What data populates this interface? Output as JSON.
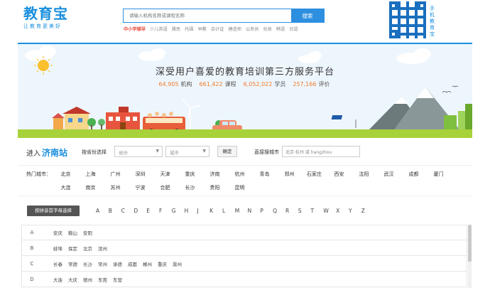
{
  "header": {
    "logo_main": "教育宝",
    "logo_sub": "让教育更美好",
    "search_placeholder": "请输入机构名称或课程名称",
    "search_button": "搜索",
    "hot_links": [
      "中小学辅导",
      "少儿英语",
      "雅思",
      "托福",
      "早教",
      "会计证",
      "建造师",
      "公务员",
      "化妆",
      "韩语",
      "日语"
    ],
    "qr_label": "手机教育宝"
  },
  "banner": {
    "title": "深受用户喜爱的教育培训第三方服务平台",
    "stats": [
      {
        "value": "64,905",
        "label": "机构"
      },
      {
        "value": "661,422",
        "label": "课程"
      },
      {
        "value": "6,052,022",
        "label": "学员"
      },
      {
        "value": "257,166",
        "label": "评价"
      }
    ]
  },
  "location": {
    "enter_label": "进入",
    "city": "济南站",
    "province_label": "按省份选择",
    "province_select": "省份",
    "city_select": "城市",
    "confirm": "确定",
    "direct_label": "直接搜城市",
    "direct_placeholder": "北京 杭州 或 hangzhou"
  },
  "hot_cities": {
    "label": "热门城市：",
    "row1": [
      "北京",
      "上海",
      "广州",
      "深圳",
      "天津",
      "重庆",
      "济南",
      "杭州",
      "青岛",
      "郑州",
      "石家庄",
      "西安",
      "沈阳",
      "武汉",
      "成都",
      "厦门"
    ],
    "row2": [
      "大连",
      "南京",
      "苏州",
      "宁波",
      "合肥",
      "长沙",
      "贵阳",
      "昆明"
    ]
  },
  "alphabet": {
    "tag": "按拼音首字母选择",
    "letters": [
      "A",
      "B",
      "C",
      "D",
      "E",
      "F",
      "G",
      "H",
      "J",
      "K",
      "L",
      "M",
      "N",
      "P",
      "Q",
      "R",
      "S",
      "T",
      "W",
      "X",
      "Y",
      "Z"
    ]
  },
  "letter_rows": [
    {
      "key": "A",
      "cities": [
        "安庆",
        "鞍山",
        "安阳"
      ]
    },
    {
      "key": "B",
      "cities": [
        "蚌埠",
        "保定",
        "北京",
        "滨州"
      ]
    },
    {
      "key": "C",
      "cities": [
        "长春",
        "常德",
        "长沙",
        "常州",
        "承德",
        "成都",
        "郴州",
        "重庆",
        "滁州"
      ]
    },
    {
      "key": "D",
      "cities": [
        "大连",
        "大庆",
        "德州",
        "东莞",
        "东营"
      ]
    }
  ],
  "colors": {
    "brand": "#1a8fdd",
    "accent": "#e94c3d",
    "stat": "#f07a2a",
    "ground": "#a7d23a"
  }
}
